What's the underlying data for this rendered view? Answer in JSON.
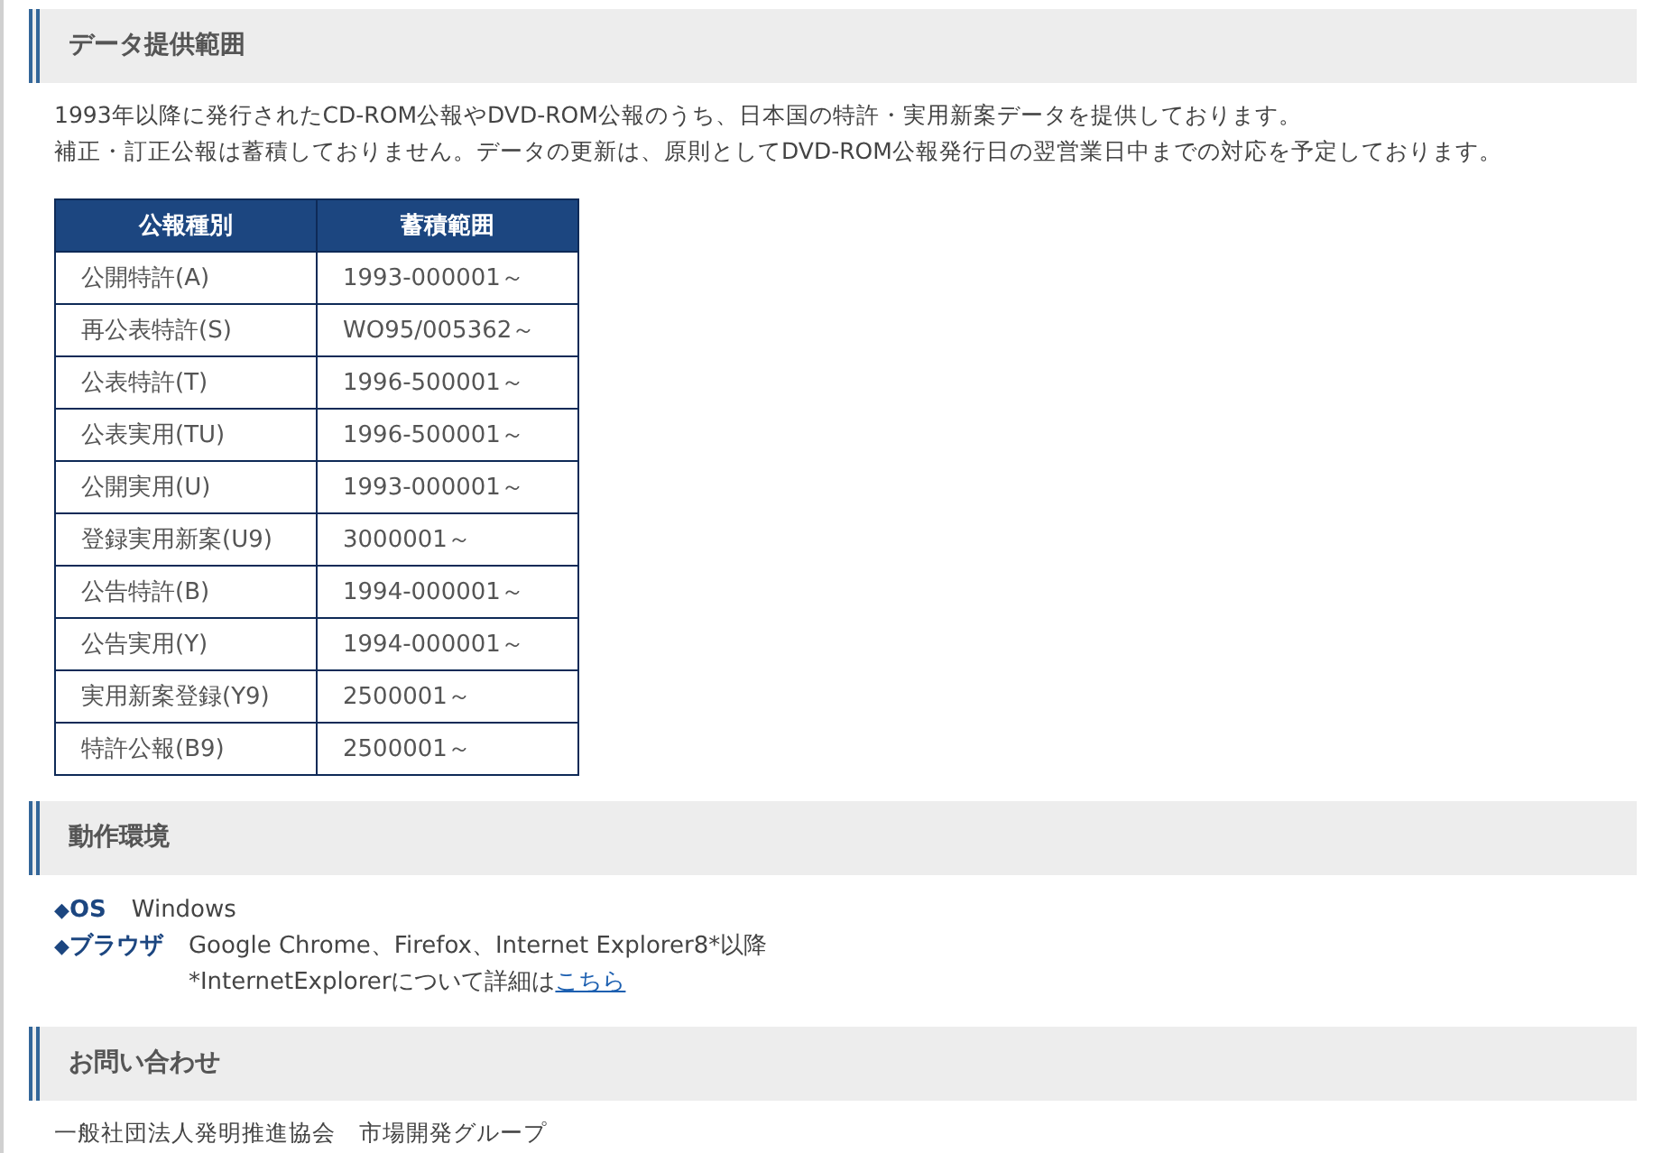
{
  "data_range": {
    "heading": "データ提供範囲",
    "paragraphs": [
      "1993年以降に発行されたCD-ROM公報やDVD-ROM公報のうち、日本国の特許・実用新案データを提供しております。",
      "補正・訂正公報は蓄積しておりません。データの更新は、原則としてDVD-ROM公報発行日の翌営業日中までの対応を予定しております。"
    ],
    "table": {
      "columns": [
        "公報種別",
        "蓄積範囲"
      ],
      "rows": [
        [
          "公開特許(A)",
          "1993-000001～"
        ],
        [
          "再公表特許(S)",
          "WO95/005362～"
        ],
        [
          "公表特許(T)",
          "1996-500001～"
        ],
        [
          "公表実用(TU)",
          "1996-500001～"
        ],
        [
          "公開実用(U)",
          "1993-000001～"
        ],
        [
          "登録実用新案(U9)",
          "3000001～"
        ],
        [
          "公告特許(B)",
          "1994-000001～"
        ],
        [
          "公告実用(Y)",
          "1994-000001～"
        ],
        [
          "実用新案登録(Y9)",
          "2500001～"
        ],
        [
          "特許公報(B9)",
          "2500001～"
        ]
      ]
    }
  },
  "environment": {
    "heading": "動作環境",
    "items": [
      {
        "marker": "◆",
        "label": "OS",
        "lines": [
          {
            "text": "Windows"
          }
        ]
      },
      {
        "marker": "◆",
        "label": "ブラウザ",
        "lines": [
          {
            "text": "Google Chrome、Firefox、Internet Explorer8*以降"
          },
          {
            "text": "*InternetExplorerについて詳細は",
            "link": "こちら"
          }
        ]
      }
    ]
  },
  "contact": {
    "heading": "お問い合わせ",
    "lines": [
      "一般社団法人発明推進協会　市場開発グループ"
    ]
  }
}
